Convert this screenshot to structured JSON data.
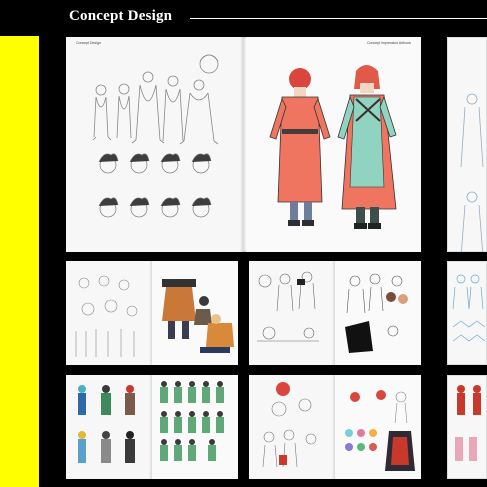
{
  "header": {
    "title": "Concept Design"
  },
  "colors": {
    "background": "#000000",
    "accent": "#ffff00",
    "character_coat": "#ef7560",
    "character_pants": "#8fd3c0",
    "character_hair": "#d9463e"
  },
  "main_spread": {
    "left_running_head": "Concept Design",
    "right_running_head": "Concept Impression Artbook"
  }
}
